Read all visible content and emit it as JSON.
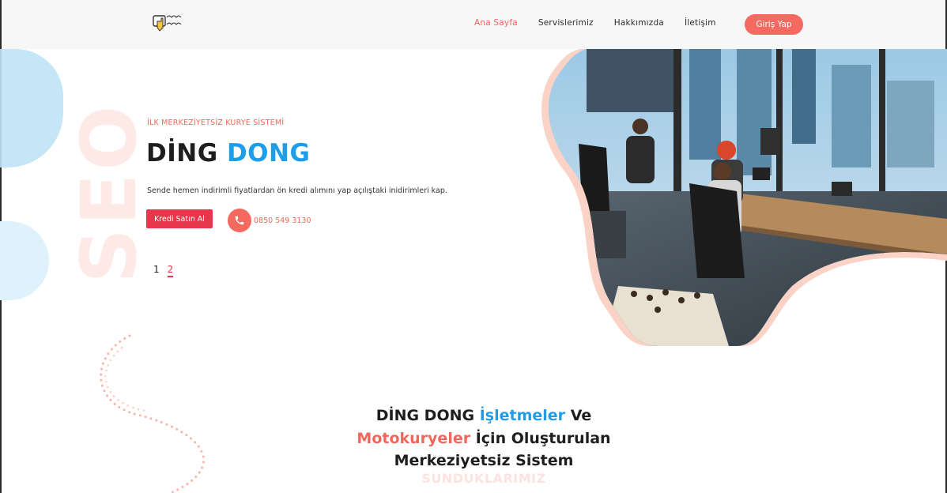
{
  "nav": {
    "logo_alt": "Ding Dong logo",
    "links": [
      {
        "label": "Ana Sayfa",
        "active": true
      },
      {
        "label": "Servislerimiz",
        "active": false
      },
      {
        "label": "Hakkımızda",
        "active": false
      },
      {
        "label": "İletişim",
        "active": false
      }
    ],
    "login_label": "Giriş Yap"
  },
  "hero": {
    "watermark": "SEO",
    "subtitle": "İLK MERKEZİYETSİZ KURYE SİSTEMİ",
    "title_part1": "DİNG",
    "title_part2": "DONG",
    "description": "Sende hemen indirimli fiyatlardan ön kredi alımını yap açılıştaki inidirimleri kap.",
    "buy_button": "Kredi Satın Al",
    "phone": "0850 549 3130",
    "pager": [
      "1",
      "2"
    ],
    "image_description": "office-photo"
  },
  "section": {
    "line1_a": "DİNG DONG",
    "line1_b": "İşletmeler",
    "line1_c": "Ve",
    "line2_a": "Motokuryeler",
    "line2_b": "İçin Oluşturulan",
    "line3": "Merkeziyetsiz Sistem",
    "sub": "SUNDUKLARIMIZ"
  },
  "colors": {
    "accent_red": "#f2675b",
    "accent_blue": "#1e9ee8",
    "button_red": "#e5384a"
  }
}
